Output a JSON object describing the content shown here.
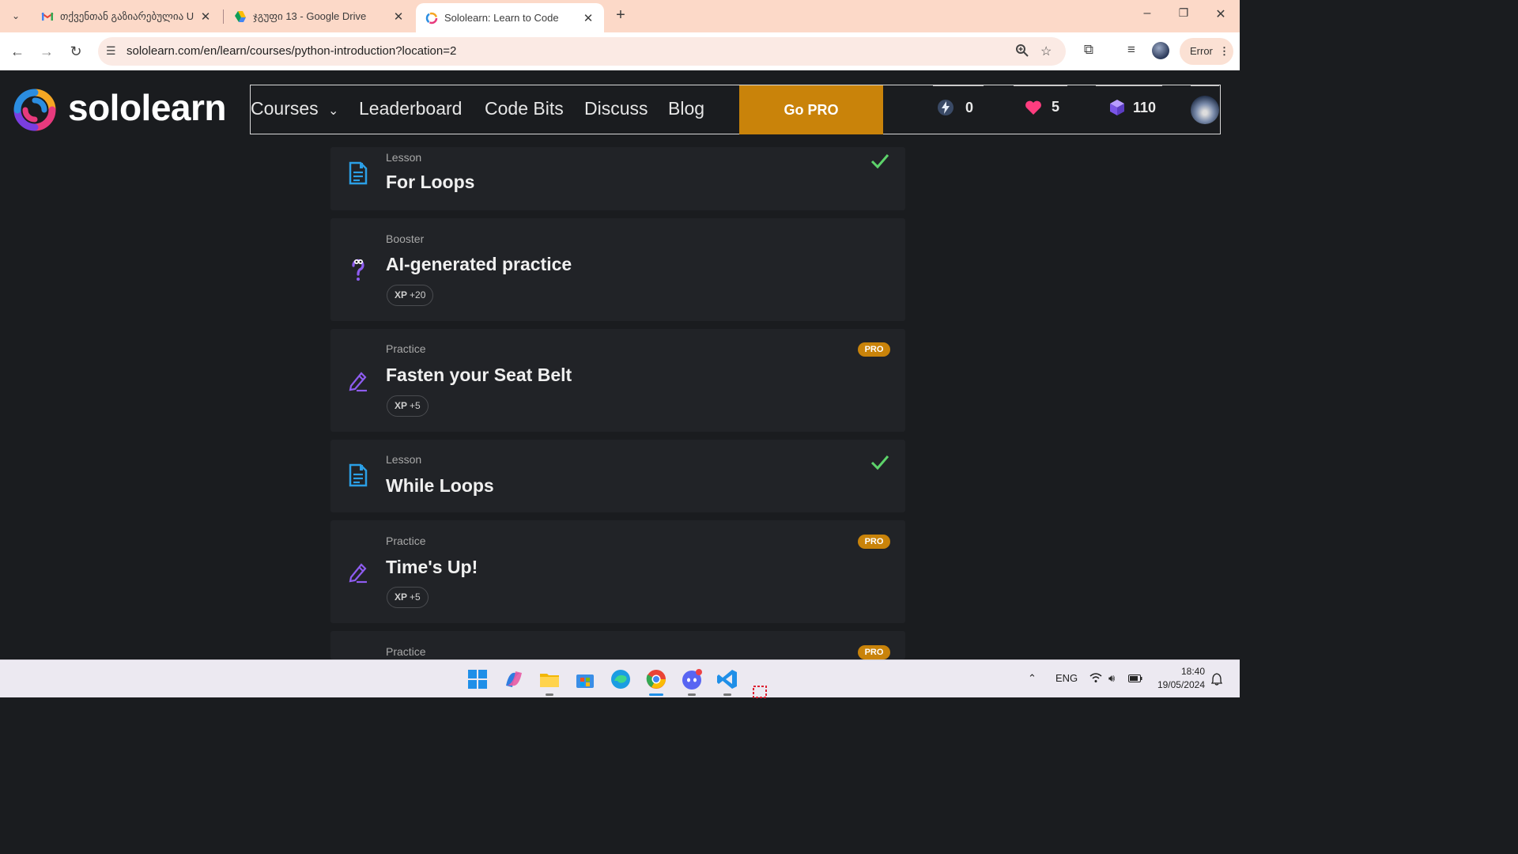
{
  "browser": {
    "tabs": [
      {
        "title": "თქვენთან გაზიარებულია U",
        "favicon": "gmail-icon",
        "active": false
      },
      {
        "title": "ჯგუფი 13 - Google Drive",
        "favicon": "drive-icon",
        "active": false
      },
      {
        "title": "Sololearn: Learn to Code",
        "favicon": "sololearn-icon",
        "active": true
      }
    ],
    "url": "sololearn.com/en/learn/courses/python-introduction?location=2",
    "profile_status": "Error"
  },
  "site": {
    "logo_text": "sololearn",
    "nav": {
      "courses": "Courses",
      "leaderboard": "Leaderboard",
      "code_bits": "Code Bits",
      "discuss": "Discuss",
      "blog": "Blog"
    },
    "go_pro": "Go PRO",
    "stats": {
      "streak": "0",
      "hearts": "5",
      "gems": "110"
    },
    "colors": {
      "accent": "#c9830a",
      "background": "#1a1c1f",
      "card": "#212327",
      "check": "#5dd36a",
      "heart": "#ff3d7f",
      "gem": "#8e6cf0"
    }
  },
  "lessons": [
    {
      "kind": "Lesson",
      "title": "For Loops",
      "completed": true,
      "icon": "lesson-icon"
    },
    {
      "kind": "Booster",
      "title": "AI-generated practice",
      "xp_label": "XP",
      "xp_value": "+20",
      "icon": "question-icon"
    },
    {
      "kind": "Practice",
      "title": "Fasten your Seat Belt",
      "badge": "PRO",
      "xp_label": "XP",
      "xp_value": "+5",
      "icon": "pencil-icon"
    },
    {
      "kind": "Lesson",
      "title": "While Loops",
      "completed": true,
      "icon": "lesson-icon"
    },
    {
      "kind": "Practice",
      "title": "Time's Up!",
      "badge": "PRO",
      "xp_label": "XP",
      "xp_value": "+5",
      "icon": "pencil-icon"
    },
    {
      "kind": "Practice",
      "title": "",
      "badge": "PRO",
      "icon": "pencil-icon"
    }
  ],
  "taskbar": {
    "language": "ENG",
    "time": "18:40",
    "date": "19/05/2024"
  }
}
